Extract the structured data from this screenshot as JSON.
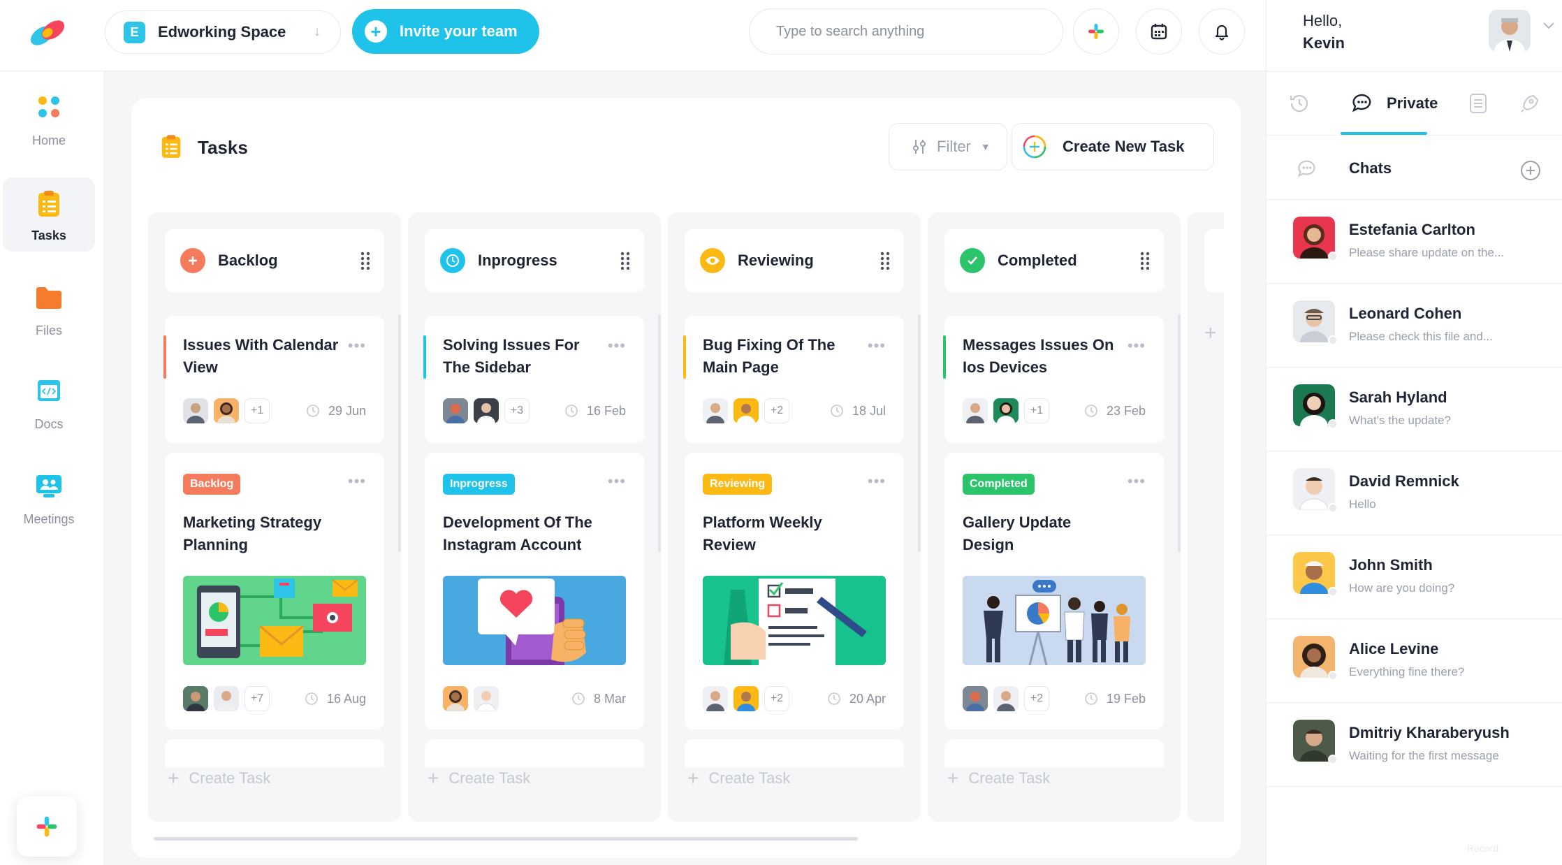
{
  "workspace": {
    "badge": "E",
    "name": "Edworking Space"
  },
  "invite_label": "Invite your team",
  "search": {
    "placeholder": "Type to search anything"
  },
  "greeting": {
    "hello": "Hello,",
    "name": "Kevin"
  },
  "sidebar": {
    "items": [
      {
        "label": "Home",
        "icon": "home-grid-icon"
      },
      {
        "label": "Tasks",
        "icon": "tasks-icon",
        "active": true
      },
      {
        "label": "Files",
        "icon": "folder-icon"
      },
      {
        "label": "Docs",
        "icon": "code-doc-icon"
      },
      {
        "label": "Meetings",
        "icon": "meetings-icon"
      }
    ]
  },
  "board": {
    "title": "Tasks",
    "filter_label": "Filter",
    "create_label": "Create New Task",
    "create_task_label": "Create Task",
    "columns": [
      {
        "name": "Backlog",
        "color": "#f47c5c",
        "card1": {
          "title": "Issues With Calendar View",
          "more": "+1",
          "date": "29 Jun"
        },
        "card2": {
          "tag": "Backlog",
          "title": "Marketing Strategy Planning",
          "more": "+7",
          "date": "16 Aug"
        }
      },
      {
        "name": "Inprogress",
        "color": "#1fc3ea",
        "card1": {
          "title": "Solving Issues For The Sidebar",
          "more": "+3",
          "date": "16 Feb"
        },
        "card2": {
          "tag": "Inprogress",
          "title": "Development Of The Instagram Account",
          "more": "",
          "date": "8 Mar"
        }
      },
      {
        "name": "Reviewing",
        "color": "#fdb913",
        "card1": {
          "title": "Bug Fixing Of The Main Page",
          "more": "+2",
          "date": "18 Jul"
        },
        "card2": {
          "tag": "Reviewing",
          "title": "Platform Weekly Review",
          "more": "+2",
          "date": "20 Apr"
        }
      },
      {
        "name": "Completed",
        "color": "#2bc46a",
        "card1": {
          "title": "Messages Issues On Ios Devices",
          "more": "+1",
          "date": "23 Feb"
        },
        "card2": {
          "tag": "Completed",
          "title": "Gallery Update Design",
          "more": "+2",
          "date": "19 Feb"
        }
      }
    ]
  },
  "right": {
    "private_label": "Private",
    "chats_label": "Chats",
    "chats": [
      {
        "name": "Estefania Carlton",
        "msg": "Please share update on the..."
      },
      {
        "name": "Leonard Cohen",
        "msg": "Please check this file and..."
      },
      {
        "name": "Sarah Hyland",
        "msg": "What's the update?"
      },
      {
        "name": "David Remnick",
        "msg": "Hello"
      },
      {
        "name": "John Smith",
        "msg": "How are you doing?"
      },
      {
        "name": "Alice Levine",
        "msg": "Everything fine there?"
      },
      {
        "name": "Dmitriy Kharaberyush",
        "msg": "Waiting for the first message"
      }
    ],
    "record_label": "Record"
  }
}
